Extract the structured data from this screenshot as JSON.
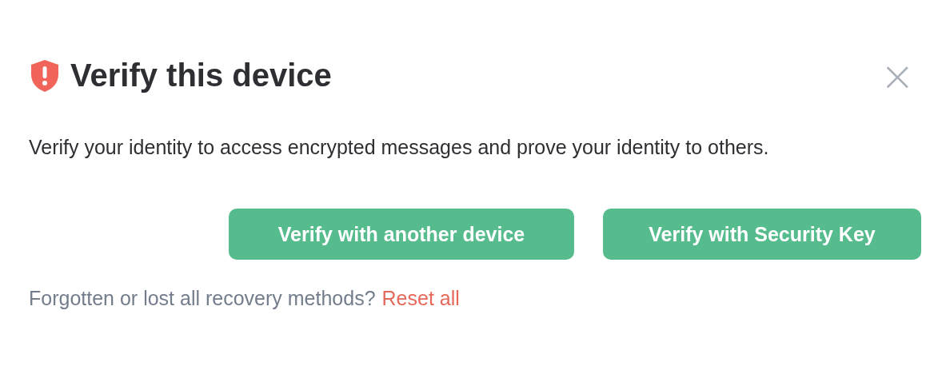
{
  "dialog": {
    "title": "Verify this device",
    "close": "×",
    "description": "Verify your identity to access encrypted messages and prove your identity to others.",
    "buttons": [
      {
        "label": "Verify with another device"
      },
      {
        "label": "Verify with Security Key"
      }
    ],
    "footer": {
      "text": "Forgotten or lost all recovery methods?",
      "link": "Reset all"
    }
  }
}
